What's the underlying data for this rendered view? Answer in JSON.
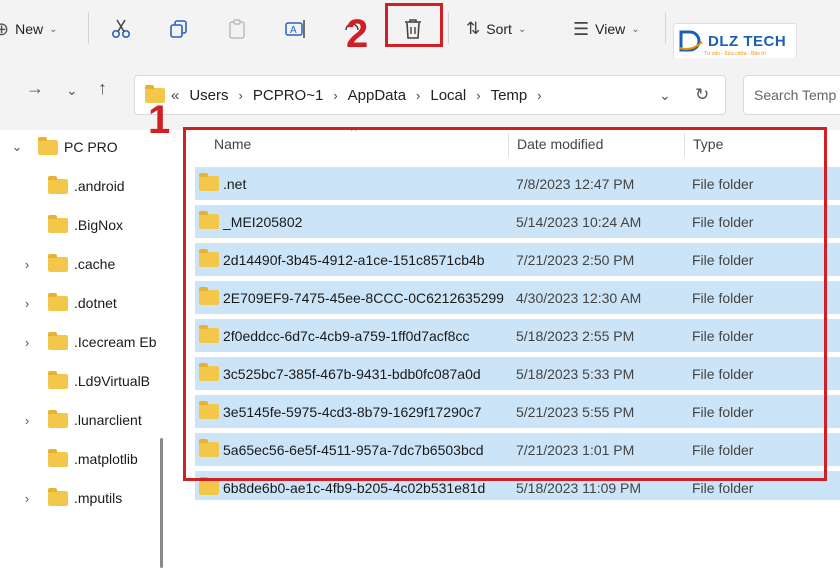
{
  "toolbar": {
    "new_label": "New",
    "sort_label": "Sort",
    "view_label": "View"
  },
  "annotations": {
    "step1": "1",
    "step2": "2"
  },
  "logo": {
    "text": "DLZ TECH",
    "subtext": "Tư vấn - Sửa chữa - Bảo trì"
  },
  "address": {
    "overflow": "«",
    "crumbs": [
      "Users",
      "PCPRO~1",
      "AppData",
      "Local",
      "Temp"
    ]
  },
  "search": {
    "placeholder": "Search Temp"
  },
  "sidebar": {
    "items": [
      {
        "label": "PC PRO",
        "chevron": "⌄"
      },
      {
        "label": ".android",
        "chevron": ""
      },
      {
        "label": ".BigNox",
        "chevron": ""
      },
      {
        "label": ".cache",
        "chevron": "›"
      },
      {
        "label": ".dotnet",
        "chevron": "›"
      },
      {
        "label": ".Icecream Eb",
        "chevron": "›"
      },
      {
        "label": ".Ld9VirtualB",
        "chevron": ""
      },
      {
        "label": ".lunarclient",
        "chevron": "›"
      },
      {
        "label": ".matplotlib",
        "chevron": ""
      },
      {
        "label": ".mputils",
        "chevron": "›"
      }
    ]
  },
  "columns": {
    "name": "Name",
    "date": "Date modified",
    "type": "Type"
  },
  "files": [
    {
      "name": ".net",
      "date": "7/8/2023 12:47 PM",
      "type": "File folder"
    },
    {
      "name": "_MEI205802",
      "date": "5/14/2023 10:24 AM",
      "type": "File folder"
    },
    {
      "name": "2d14490f-3b45-4912-a1ce-151c8571cb4b",
      "date": "7/21/2023 2:50 PM",
      "type": "File folder"
    },
    {
      "name": "2E709EF9-7475-45ee-8CCC-0C6212635299",
      "date": "4/30/2023 12:30 AM",
      "type": "File folder"
    },
    {
      "name": "2f0eddcc-6d7c-4cb9-a759-1ff0d7acf8cc",
      "date": "5/18/2023 2:55 PM",
      "type": "File folder"
    },
    {
      "name": "3c525bc7-385f-467b-9431-bdb0fc087a0d",
      "date": "5/18/2023 5:33 PM",
      "type": "File folder"
    },
    {
      "name": "3e5145fe-5975-4cd3-8b79-1629f17290c7",
      "date": "5/21/2023 5:55 PM",
      "type": "File folder"
    },
    {
      "name": "5a65ec56-6e5f-4511-957a-7dc7b6503bcd",
      "date": "7/21/2023 1:01 PM",
      "type": "File folder"
    },
    {
      "name": "6b8de6b0-ae1c-4fb9-b205-4c02b531e81d",
      "date": "5/18/2023 11:09 PM",
      "type": "File folder"
    }
  ],
  "colors": {
    "selection": "#cce4f7",
    "annotation": "#d11f26",
    "folder": "#f3c74a"
  }
}
